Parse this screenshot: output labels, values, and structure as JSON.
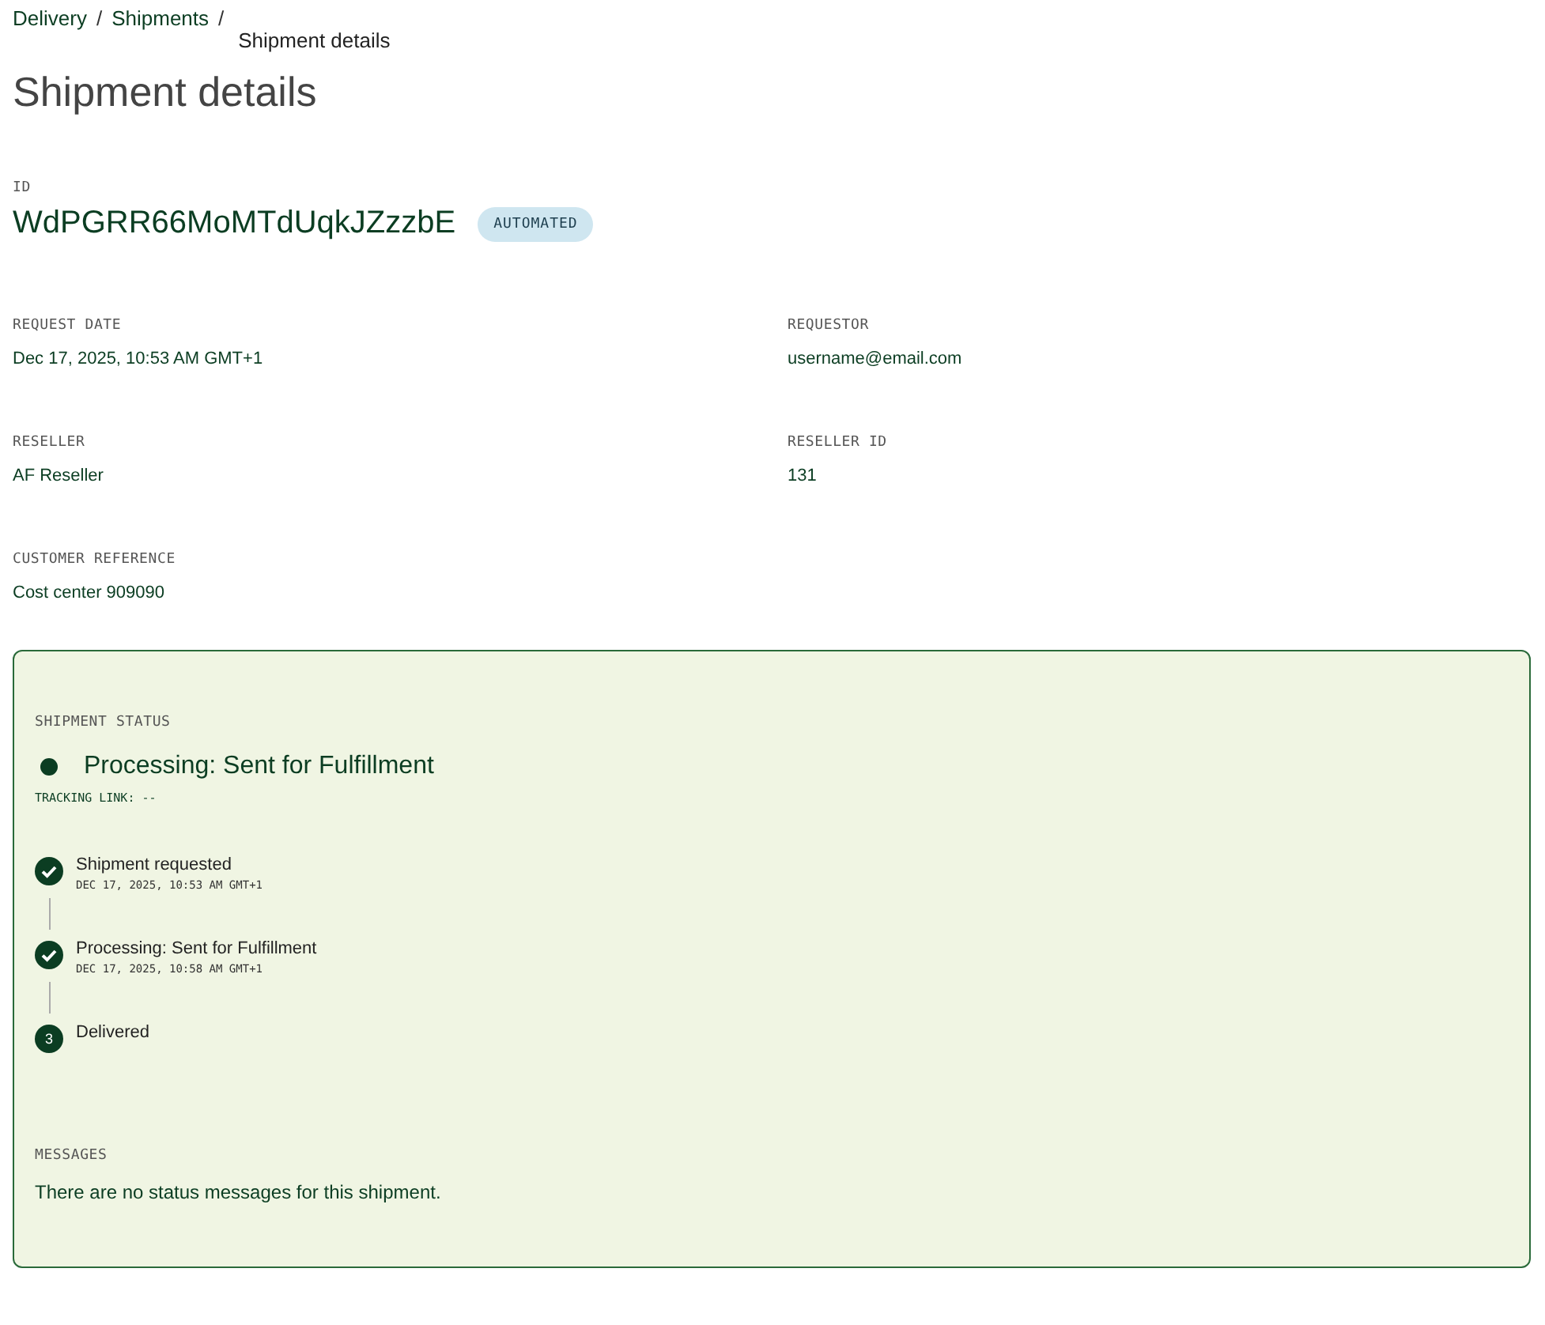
{
  "breadcrumb": [
    {
      "label": "Delivery",
      "current": false
    },
    {
      "label": "Shipments",
      "current": false
    },
    {
      "label": "Shipment details",
      "current": true
    }
  ],
  "separator": "/",
  "title": "Shipment details",
  "id": {
    "label": "ID",
    "value": "WdPGRR66MoMTdUqkJZzzbE",
    "badge": "AUTOMATED"
  },
  "fields": [
    {
      "label": "REQUEST DATE",
      "value": "Dec 17, 2025, 10:53 AM GMT+1"
    },
    {
      "label": "REQUESTOR",
      "value": "username@email.com"
    },
    {
      "label": "RESELLER",
      "value": "AF Reseller"
    },
    {
      "label": "RESELLER ID",
      "value": "131"
    },
    {
      "label": "CUSTOMER REFERENCE",
      "value": "Cost center 909090"
    }
  ],
  "status": {
    "label": "SHIPMENT STATUS",
    "current": "Processing: Sent for Fulfillment",
    "tracking": "TRACKING LINK: --",
    "steps": [
      {
        "title": "Shipment requested",
        "time": "DEC 17, 2025, 10:53 AM GMT+1",
        "completed": true
      },
      {
        "title": "Processing: Sent for Fulfillment",
        "time": "DEC 17, 2025, 10:58 AM GMT+1",
        "completed": true
      },
      {
        "title": "Delivered",
        "number": "3",
        "completed": false
      }
    ],
    "messages_label": "MESSAGES",
    "messages": "There are no status messages for this shipment."
  }
}
